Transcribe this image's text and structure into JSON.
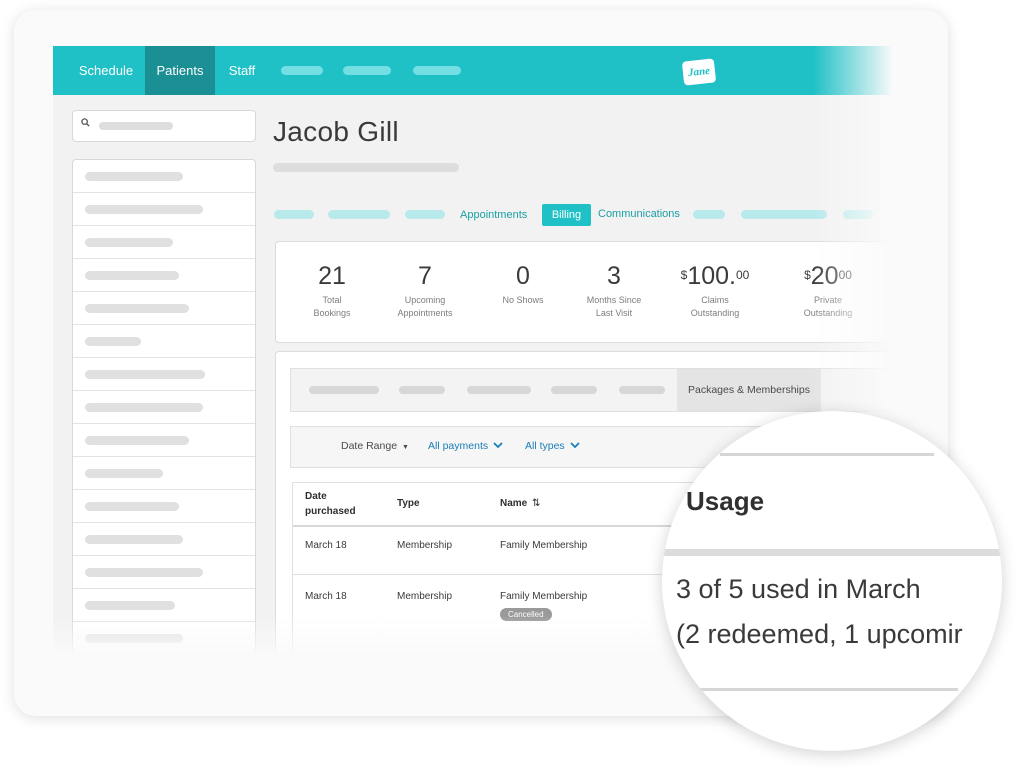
{
  "nav": {
    "items": [
      {
        "label": "Schedule"
      },
      {
        "label": "Patients"
      },
      {
        "label": "Staff"
      }
    ],
    "active": "Patients",
    "logo_text": "Jane"
  },
  "patient": {
    "name": "Jacob Gill"
  },
  "tabs": {
    "appointments": "Appointments",
    "billing": "Billing",
    "communications": "Communications"
  },
  "stats": [
    {
      "value": "21",
      "label1": "Total",
      "label2": "Bookings"
    },
    {
      "value": "7",
      "label1": "Upcoming",
      "label2": "Appointments"
    },
    {
      "value": "0",
      "label1": "No Shows",
      "label2": ""
    },
    {
      "value": "3",
      "label1": "Months Since",
      "label2": "Last Visit"
    },
    {
      "prefix": "$",
      "value": "100.",
      "cents": "00",
      "label1": "Claims",
      "label2": "Outstanding"
    },
    {
      "prefix": "$",
      "value": "20",
      "cents": "00",
      "label1": "Private",
      "label2": "Outstanding"
    }
  ],
  "subtabs": {
    "active": "Packages & Memberships"
  },
  "filters": {
    "date_range": "Date Range",
    "payments": "All payments",
    "types": "All types"
  },
  "table": {
    "headers": {
      "date_line1": "Date",
      "date_line2": "purchased",
      "type": "Type",
      "name": "Name"
    },
    "rows": [
      {
        "date": "March 18",
        "type": "Membership",
        "name": "Family Membership",
        "status": ""
      },
      {
        "date": "March 18",
        "type": "Membership",
        "name": "Family Membership",
        "status": "Cancelled"
      }
    ]
  },
  "magnifier": {
    "heading": "Usage",
    "line1": "3 of 5 used in March",
    "line2": "(2 redeemed, 1 upcomir"
  },
  "colors": {
    "brand": "#1fc0c6",
    "nav_active": "#1a8f94",
    "link": "#1a7fb8"
  }
}
